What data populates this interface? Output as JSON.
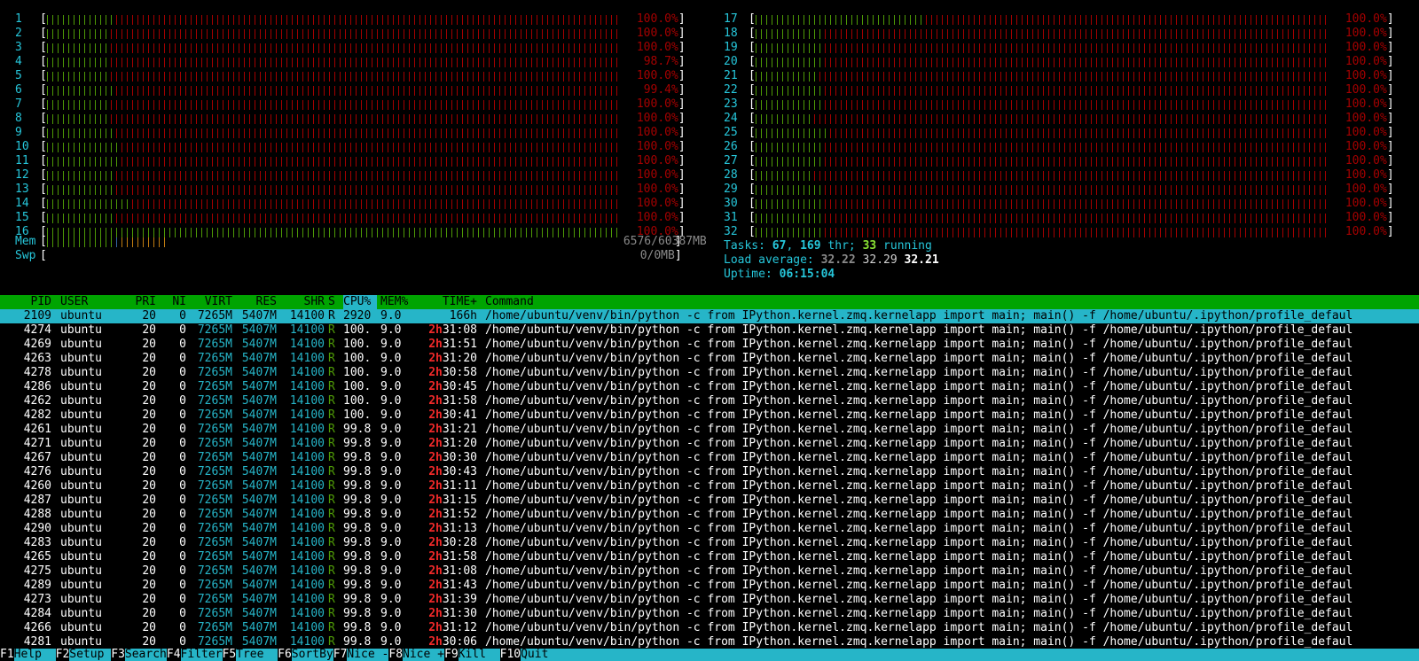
{
  "cpus_left": [
    {
      "num": "1",
      "pct": "100.0%",
      "green": 13
    },
    {
      "num": "2",
      "pct": "100.0%",
      "green": 12
    },
    {
      "num": "3",
      "pct": "100.0%",
      "green": 12
    },
    {
      "num": "4",
      "pct": "98.7%",
      "green": 12
    },
    {
      "num": "5",
      "pct": "100.0%",
      "green": 12
    },
    {
      "num": "6",
      "pct": "99.4%",
      "green": 13
    },
    {
      "num": "7",
      "pct": "100.0%",
      "green": 12
    },
    {
      "num": "8",
      "pct": "100.0%",
      "green": 12
    },
    {
      "num": "9",
      "pct": "100.0%",
      "green": 13
    },
    {
      "num": "10",
      "pct": "100.0%",
      "green": 14
    },
    {
      "num": "11",
      "pct": "100.0%",
      "green": 14
    },
    {
      "num": "12",
      "pct": "100.0%",
      "green": 13
    },
    {
      "num": "13",
      "pct": "100.0%",
      "green": 13
    },
    {
      "num": "14",
      "pct": "100.0%",
      "green": 16
    },
    {
      "num": "15",
      "pct": "100.0%",
      "green": 13
    },
    {
      "num": "16",
      "pct": "100.0%",
      "green": 110
    }
  ],
  "cpus_right": [
    {
      "num": "17",
      "pct": "100.0%",
      "green": 32
    },
    {
      "num": "18",
      "pct": "100.0%",
      "green": 13
    },
    {
      "num": "19",
      "pct": "100.0%",
      "green": 13
    },
    {
      "num": "20",
      "pct": "100.0%",
      "green": 13
    },
    {
      "num": "21",
      "pct": "100.0%",
      "green": 12
    },
    {
      "num": "22",
      "pct": "100.0%",
      "green": 13
    },
    {
      "num": "23",
      "pct": "100.0%",
      "green": 13
    },
    {
      "num": "24",
      "pct": "100.0%",
      "green": 11
    },
    {
      "num": "25",
      "pct": "100.0%",
      "green": 14
    },
    {
      "num": "26",
      "pct": "100.0%",
      "green": 13
    },
    {
      "num": "27",
      "pct": "100.0%",
      "green": 13
    },
    {
      "num": "28",
      "pct": "100.0%",
      "green": 11
    },
    {
      "num": "29",
      "pct": "100.0%",
      "green": 13
    },
    {
      "num": "30",
      "pct": "100.0%",
      "green": 13
    },
    {
      "num": "31",
      "pct": "100.0%",
      "green": 13
    },
    {
      "num": "32",
      "pct": "100.0%",
      "green": 13
    }
  ],
  "mem": {
    "label": "Mem",
    "value": "6576/60387MB"
  },
  "swp": {
    "label": "Swp",
    "value": "0/0MB"
  },
  "tasks": {
    "label": "Tasks:",
    "count": "67",
    "sep": ",",
    "thr": "169",
    "thr_label": "thr;",
    "running": "33",
    "running_label": "running"
  },
  "load": {
    "label": "Load average:",
    "one": "32.22",
    "five": "32.29",
    "fifteen": "32.21"
  },
  "uptime": {
    "label": "Uptime:",
    "value": "06:15:04"
  },
  "columns": {
    "pid": "PID",
    "user": "USER",
    "pri": "PRI",
    "ni": "NI",
    "virt": "VIRT",
    "res": "RES",
    "shr": "SHR",
    "s": "S",
    "cpu": "CPU%",
    "mem": "MEM%",
    "time": "TIME+",
    "cmd": "Command"
  },
  "command": "/home/ubuntu/venv/bin/python -c from IPython.kernel.zmq.kernelapp import main; main() -f /home/ubuntu/.ipython/profile_defaul",
  "processes": [
    {
      "pid": "2109",
      "user": "ubuntu",
      "pri": "20",
      "ni": "0",
      "virt": "7265M",
      "res": "5407M",
      "shr": "14100",
      "s": "R",
      "cpu": "2920",
      "mem": "9.0",
      "time_h": "",
      "time": "166h"
    },
    {
      "pid": "4274",
      "user": "ubuntu",
      "pri": "20",
      "ni": "0",
      "virt": "7265M",
      "res": "5407M",
      "shr": "14100",
      "s": "R",
      "cpu": "100.",
      "mem": "9.0",
      "time_h": "2h",
      "time": "31:08"
    },
    {
      "pid": "4269",
      "user": "ubuntu",
      "pri": "20",
      "ni": "0",
      "virt": "7265M",
      "res": "5407M",
      "shr": "14100",
      "s": "R",
      "cpu": "100.",
      "mem": "9.0",
      "time_h": "2h",
      "time": "31:51"
    },
    {
      "pid": "4263",
      "user": "ubuntu",
      "pri": "20",
      "ni": "0",
      "virt": "7265M",
      "res": "5407M",
      "shr": "14100",
      "s": "R",
      "cpu": "100.",
      "mem": "9.0",
      "time_h": "2h",
      "time": "31:20"
    },
    {
      "pid": "4278",
      "user": "ubuntu",
      "pri": "20",
      "ni": "0",
      "virt": "7265M",
      "res": "5407M",
      "shr": "14100",
      "s": "R",
      "cpu": "100.",
      "mem": "9.0",
      "time_h": "2h",
      "time": "30:58"
    },
    {
      "pid": "4286",
      "user": "ubuntu",
      "pri": "20",
      "ni": "0",
      "virt": "7265M",
      "res": "5407M",
      "shr": "14100",
      "s": "R",
      "cpu": "100.",
      "mem": "9.0",
      "time_h": "2h",
      "time": "30:45"
    },
    {
      "pid": "4262",
      "user": "ubuntu",
      "pri": "20",
      "ni": "0",
      "virt": "7265M",
      "res": "5407M",
      "shr": "14100",
      "s": "R",
      "cpu": "100.",
      "mem": "9.0",
      "time_h": "2h",
      "time": "31:58"
    },
    {
      "pid": "4282",
      "user": "ubuntu",
      "pri": "20",
      "ni": "0",
      "virt": "7265M",
      "res": "5407M",
      "shr": "14100",
      "s": "R",
      "cpu": "100.",
      "mem": "9.0",
      "time_h": "2h",
      "time": "30:41"
    },
    {
      "pid": "4261",
      "user": "ubuntu",
      "pri": "20",
      "ni": "0",
      "virt": "7265M",
      "res": "5407M",
      "shr": "14100",
      "s": "R",
      "cpu": "99.8",
      "mem": "9.0",
      "time_h": "2h",
      "time": "31:21"
    },
    {
      "pid": "4271",
      "user": "ubuntu",
      "pri": "20",
      "ni": "0",
      "virt": "7265M",
      "res": "5407M",
      "shr": "14100",
      "s": "R",
      "cpu": "99.8",
      "mem": "9.0",
      "time_h": "2h",
      "time": "31:20"
    },
    {
      "pid": "4267",
      "user": "ubuntu",
      "pri": "20",
      "ni": "0",
      "virt": "7265M",
      "res": "5407M",
      "shr": "14100",
      "s": "R",
      "cpu": "99.8",
      "mem": "9.0",
      "time_h": "2h",
      "time": "30:30"
    },
    {
      "pid": "4276",
      "user": "ubuntu",
      "pri": "20",
      "ni": "0",
      "virt": "7265M",
      "res": "5407M",
      "shr": "14100",
      "s": "R",
      "cpu": "99.8",
      "mem": "9.0",
      "time_h": "2h",
      "time": "30:43"
    },
    {
      "pid": "4260",
      "user": "ubuntu",
      "pri": "20",
      "ni": "0",
      "virt": "7265M",
      "res": "5407M",
      "shr": "14100",
      "s": "R",
      "cpu": "99.8",
      "mem": "9.0",
      "time_h": "2h",
      "time": "31:11"
    },
    {
      "pid": "4287",
      "user": "ubuntu",
      "pri": "20",
      "ni": "0",
      "virt": "7265M",
      "res": "5407M",
      "shr": "14100",
      "s": "R",
      "cpu": "99.8",
      "mem": "9.0",
      "time_h": "2h",
      "time": "31:15"
    },
    {
      "pid": "4288",
      "user": "ubuntu",
      "pri": "20",
      "ni": "0",
      "virt": "7265M",
      "res": "5407M",
      "shr": "14100",
      "s": "R",
      "cpu": "99.8",
      "mem": "9.0",
      "time_h": "2h",
      "time": "31:52"
    },
    {
      "pid": "4290",
      "user": "ubuntu",
      "pri": "20",
      "ni": "0",
      "virt": "7265M",
      "res": "5407M",
      "shr": "14100",
      "s": "R",
      "cpu": "99.8",
      "mem": "9.0",
      "time_h": "2h",
      "time": "31:13"
    },
    {
      "pid": "4283",
      "user": "ubuntu",
      "pri": "20",
      "ni": "0",
      "virt": "7265M",
      "res": "5407M",
      "shr": "14100",
      "s": "R",
      "cpu": "99.8",
      "mem": "9.0",
      "time_h": "2h",
      "time": "30:28"
    },
    {
      "pid": "4265",
      "user": "ubuntu",
      "pri": "20",
      "ni": "0",
      "virt": "7265M",
      "res": "5407M",
      "shr": "14100",
      "s": "R",
      "cpu": "99.8",
      "mem": "9.0",
      "time_h": "2h",
      "time": "31:58"
    },
    {
      "pid": "4275",
      "user": "ubuntu",
      "pri": "20",
      "ni": "0",
      "virt": "7265M",
      "res": "5407M",
      "shr": "14100",
      "s": "R",
      "cpu": "99.8",
      "mem": "9.0",
      "time_h": "2h",
      "time": "31:08"
    },
    {
      "pid": "4289",
      "user": "ubuntu",
      "pri": "20",
      "ni": "0",
      "virt": "7265M",
      "res": "5407M",
      "shr": "14100",
      "s": "R",
      "cpu": "99.8",
      "mem": "9.0",
      "time_h": "2h",
      "time": "31:43"
    },
    {
      "pid": "4273",
      "user": "ubuntu",
      "pri": "20",
      "ni": "0",
      "virt": "7265M",
      "res": "5407M",
      "shr": "14100",
      "s": "R",
      "cpu": "99.8",
      "mem": "9.0",
      "time_h": "2h",
      "time": "31:39"
    },
    {
      "pid": "4284",
      "user": "ubuntu",
      "pri": "20",
      "ni": "0",
      "virt": "7265M",
      "res": "5407M",
      "shr": "14100",
      "s": "R",
      "cpu": "99.8",
      "mem": "9.0",
      "time_h": "2h",
      "time": "31:30"
    },
    {
      "pid": "4266",
      "user": "ubuntu",
      "pri": "20",
      "ni": "0",
      "virt": "7265M",
      "res": "5407M",
      "shr": "14100",
      "s": "R",
      "cpu": "99.8",
      "mem": "9.0",
      "time_h": "2h",
      "time": "31:12"
    },
    {
      "pid": "4281",
      "user": "ubuntu",
      "pri": "20",
      "ni": "0",
      "virt": "7265M",
      "res": "5407M",
      "shr": "14100",
      "s": "R",
      "cpu": "99.8",
      "mem": "9.0",
      "time_h": "2h",
      "time": "30:06"
    }
  ],
  "fkeys": [
    {
      "key": "F1",
      "label": "Help  "
    },
    {
      "key": "F2",
      "label": "Setup "
    },
    {
      "key": "F3",
      "label": "Search"
    },
    {
      "key": "F4",
      "label": "Filter"
    },
    {
      "key": "F5",
      "label": "Tree  "
    },
    {
      "key": "F6",
      "label": "SortBy"
    },
    {
      "key": "F7",
      "label": "Nice -"
    },
    {
      "key": "F8",
      "label": "Nice +"
    },
    {
      "key": "F9",
      "label": "Kill  "
    },
    {
      "key": "F10",
      "label": "Quit  "
    }
  ],
  "colors": {
    "green": "#4e9a06",
    "red": "#a40000",
    "blue": "#3465a4",
    "orange": "#c17d11",
    "cyan": "#26c6da",
    "header": "#00a400",
    "selected": "#26b5c8"
  }
}
